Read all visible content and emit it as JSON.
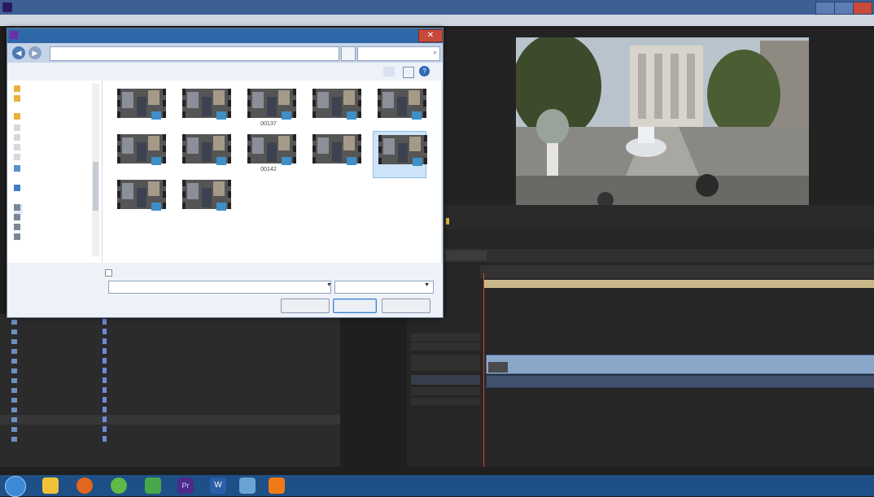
{
  "app": {
    "title": "",
    "menu": [
      "",
      "",
      "",
      "",
      "",
      "",
      "",
      ""
    ]
  },
  "dialog": {
    "title": "",
    "breadcrumbs": [
      "",
      "",
      ""
    ],
    "search_placeholder": "",
    "toolbar": {
      "organize": "",
      "new_folder": ""
    },
    "sidebar": [
      "",
      "",
      "",
      "",
      "",
      "",
      "",
      "",
      "",
      "",
      "",
      "",
      ""
    ],
    "files": [
      "",
      "",
      "00137",
      "",
      "",
      "",
      "",
      "00142",
      "",
      "",
      "",
      ""
    ],
    "selected_index": 9,
    "thumbnail_checkbox_label": "",
    "file_name_label": "",
    "file_name_value": "",
    "filter_value": "",
    "buttons": {
      "import_folder": "",
      "open": "",
      "cancel": ""
    }
  },
  "program_monitor": {
    "timecode_left": "",
    "timecode_right": ""
  },
  "timeline": {
    "tracks": [
      "",
      "",
      "",
      "",
      "",
      "",
      ""
    ],
    "video_clip_label": "",
    "audio_clip_label": ""
  },
  "project": {
    "rows": [
      [
        "",
        "",
        "",
        "",
        "",
        ""
      ],
      [
        "",
        "",
        "",
        "",
        "",
        ""
      ],
      [
        "",
        "",
        "",
        "",
        "",
        ""
      ],
      [
        "",
        "",
        "",
        "",
        "",
        ""
      ],
      [
        "",
        "",
        "",
        "",
        "",
        ""
      ],
      [
        "",
        "",
        "",
        "",
        "",
        ""
      ],
      [
        "",
        "",
        "",
        "",
        "",
        ""
      ],
      [
        "",
        "",
        "",
        "",
        "",
        ""
      ],
      [
        "",
        "",
        "",
        "",
        "",
        ""
      ],
      [
        "",
        "",
        "",
        "",
        "",
        ""
      ],
      [
        "",
        "",
        "",
        "",
        "",
        ""
      ],
      [
        "",
        "",
        "",
        "",
        "",
        ""
      ],
      [
        "",
        "",
        "",
        "",
        "",
        ""
      ]
    ]
  },
  "taskbar": {
    "tray": "",
    "time": "",
    "date": ""
  }
}
